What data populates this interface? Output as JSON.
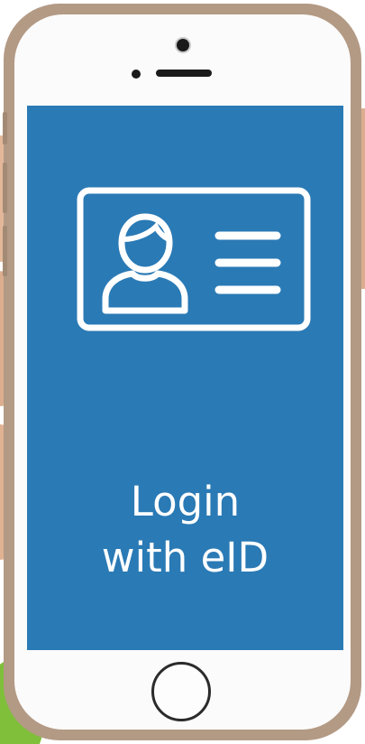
{
  "screen": {
    "background_color": "#2a7ab5",
    "icon": "id-card-icon",
    "title_line1": "Login",
    "title_line2": "with eID"
  },
  "device": {
    "frame_color": "#b39a85",
    "face_color": "#fbfbfb"
  }
}
